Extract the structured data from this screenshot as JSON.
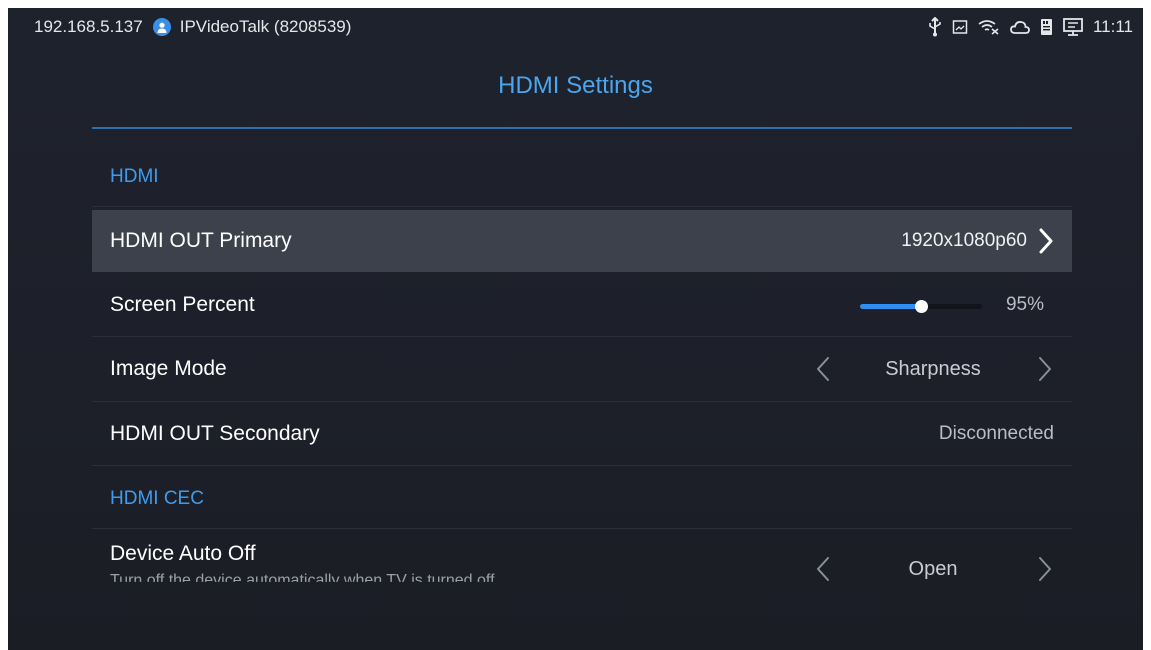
{
  "status_bar": {
    "ip": "192.168.5.137",
    "account": "IPVideoTalk (8208539)",
    "time": "11:11",
    "icons": [
      "usb-icon",
      "screen-capture-icon",
      "wifi-off-icon",
      "cloud-icon",
      "sd-card-icon",
      "display-output-icon"
    ]
  },
  "title": "HDMI Settings",
  "sections": {
    "hdmi": "HDMI",
    "hdmi_cec": "HDMI CEC"
  },
  "rows": {
    "hdmi_out_primary": {
      "label": "HDMI OUT Primary",
      "value": "1920x1080p60"
    },
    "screen_percent": {
      "label": "Screen Percent",
      "value": "95%",
      "level": 0.5
    },
    "image_mode": {
      "label": "Image Mode",
      "value": "Sharpness"
    },
    "hdmi_out_secondary": {
      "label": "HDMI OUT Secondary",
      "value": "Disconnected"
    },
    "device_auto_off": {
      "label": "Device Auto Off",
      "description": "Turn off the device automatically when TV is turned off",
      "value": "Open"
    }
  },
  "colors": {
    "accent": "#3c9df0",
    "background": "#1d2029",
    "selected_row": "#3c414c",
    "slider_fill": "#2f8ff0"
  }
}
